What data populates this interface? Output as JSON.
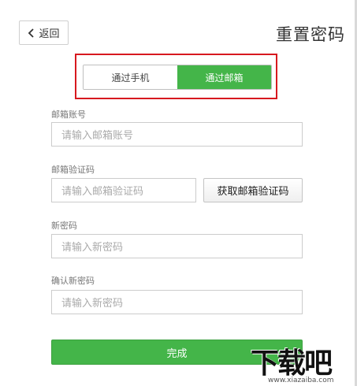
{
  "header": {
    "back_label": "返回",
    "title": "重置密码"
  },
  "toggle": {
    "phone_label": "通过手机",
    "email_label": "通过邮箱",
    "active": "email"
  },
  "form": {
    "email": {
      "label": "邮箱账号",
      "placeholder": "请输入邮箱账号"
    },
    "code": {
      "label": "邮箱验证码",
      "placeholder": "请输入邮箱验证码",
      "button_label": "获取邮箱验证码"
    },
    "new_password": {
      "label": "新密码",
      "placeholder": "请输入新密码"
    },
    "confirm_password": {
      "label": "确认新密码",
      "placeholder": "请输入新密码"
    },
    "submit_label": "完成"
  },
  "watermark": {
    "text": "下载吧",
    "url": "www.xiazaiba.com"
  },
  "colors": {
    "accent_green": "#44b549",
    "highlight_red": "#d7191f"
  }
}
